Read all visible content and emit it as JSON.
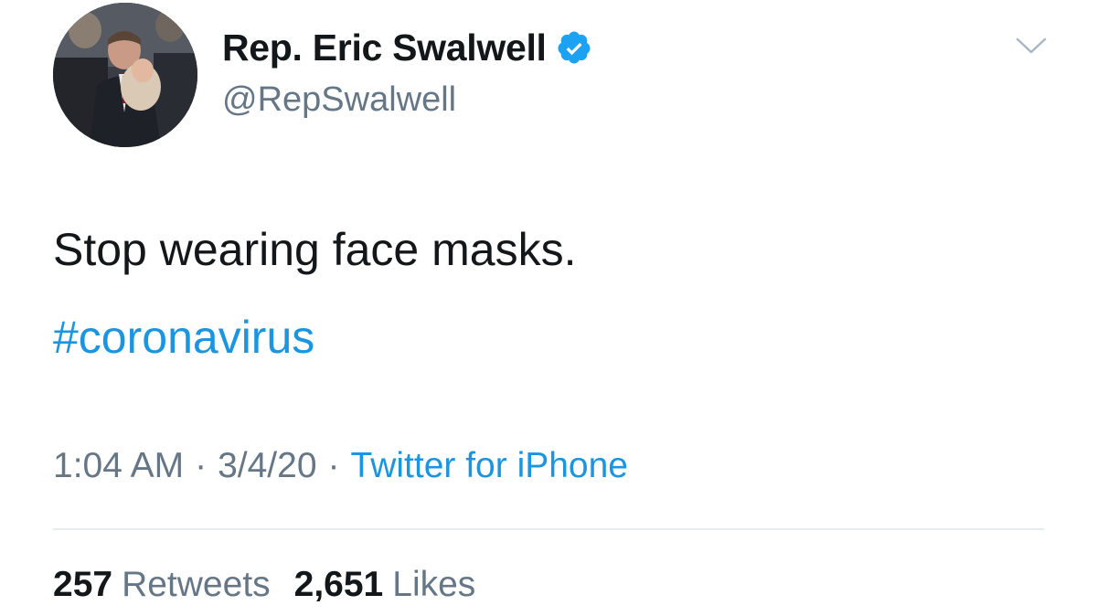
{
  "author": {
    "display_name": "Rep. Eric Swalwell",
    "handle": "@RepSwalwell",
    "verified_icon": "verified-badge-icon",
    "avatar": "profile-photo"
  },
  "menu": {
    "icon": "chevron-down-icon"
  },
  "tweet": {
    "text": "Stop wearing face masks.",
    "hashtag": "#coronavirus"
  },
  "meta": {
    "time": "1:04 AM",
    "separator": "·",
    "date": "3/4/20",
    "source": "Twitter for iPhone"
  },
  "stats": {
    "retweets_count": "257",
    "retweets_label": "Retweets",
    "likes_count": "2,651",
    "likes_label": "Likes"
  },
  "colors": {
    "link": "#1b95e0",
    "secondary_text": "#657786",
    "primary_text": "#14171a",
    "divider": "#e6ecf0"
  }
}
